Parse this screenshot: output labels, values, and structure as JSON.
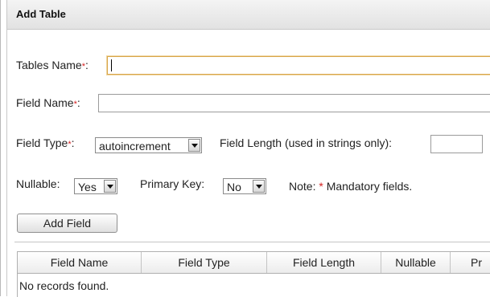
{
  "dialog": {
    "title": "Add Table"
  },
  "form": {
    "tables_name": {
      "label": "Tables Name",
      "required_mark": "*",
      "colon": ":",
      "value": ""
    },
    "field_name": {
      "label": "Field Name",
      "required_mark": "*",
      "colon": ":",
      "value": ""
    },
    "field_type": {
      "label": "Field Type",
      "required_mark": "*",
      "colon": ":",
      "selected": "autoincrement"
    },
    "field_length": {
      "label": "Field Length (used in strings only):",
      "value": ""
    },
    "nullable": {
      "label": "Nullable:",
      "selected": "Yes"
    },
    "primary_key": {
      "label": "Primary Key:",
      "selected": "No"
    },
    "note": {
      "prefix": "Note: ",
      "mark": "*",
      "text": " Mandatory fields."
    },
    "add_field_label": "Add Field"
  },
  "grid": {
    "columns": [
      "Field Name",
      "Field Type",
      "Field Length",
      "Nullable",
      "Pr"
    ],
    "empty_text": "No records found."
  },
  "colors": {
    "required": "#d42020",
    "focus_border": "#d8a54a"
  }
}
